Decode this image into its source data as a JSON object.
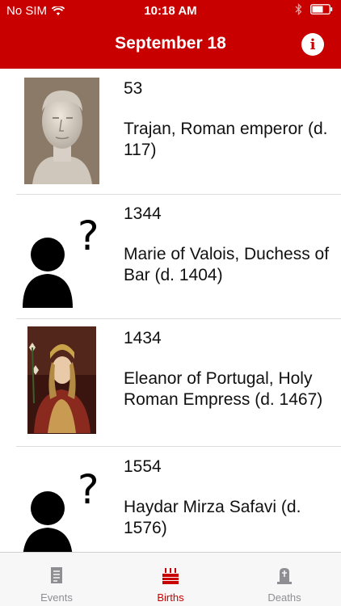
{
  "status": {
    "carrier": "No SIM",
    "time": "10:18 AM"
  },
  "nav": {
    "title": "September 18",
    "info_label": "i"
  },
  "list": {
    "items": [
      {
        "year": "53",
        "name": "Trajan, Roman emperor (d. 117)",
        "image": "portrait-bust"
      },
      {
        "year": "1344",
        "name": "Marie of Valois, Duchess of Bar (d. 1404)",
        "image": "unknown-person"
      },
      {
        "year": "1434",
        "name": "Eleanor of Portugal, Holy Roman Empress (d. 1467)",
        "image": "portrait-painting"
      },
      {
        "year": "1554",
        "name": "Haydar Mirza Safavi (d. 1576)",
        "image": "unknown-person"
      }
    ]
  },
  "tabs": [
    {
      "label": "Events",
      "icon": "document-icon",
      "active": false
    },
    {
      "label": "Births",
      "icon": "cake-icon",
      "active": true
    },
    {
      "label": "Deaths",
      "icon": "tombstone-icon",
      "active": false
    }
  ],
  "colors": {
    "accent": "#c80000",
    "tab_inactive": "#8e8e93"
  }
}
